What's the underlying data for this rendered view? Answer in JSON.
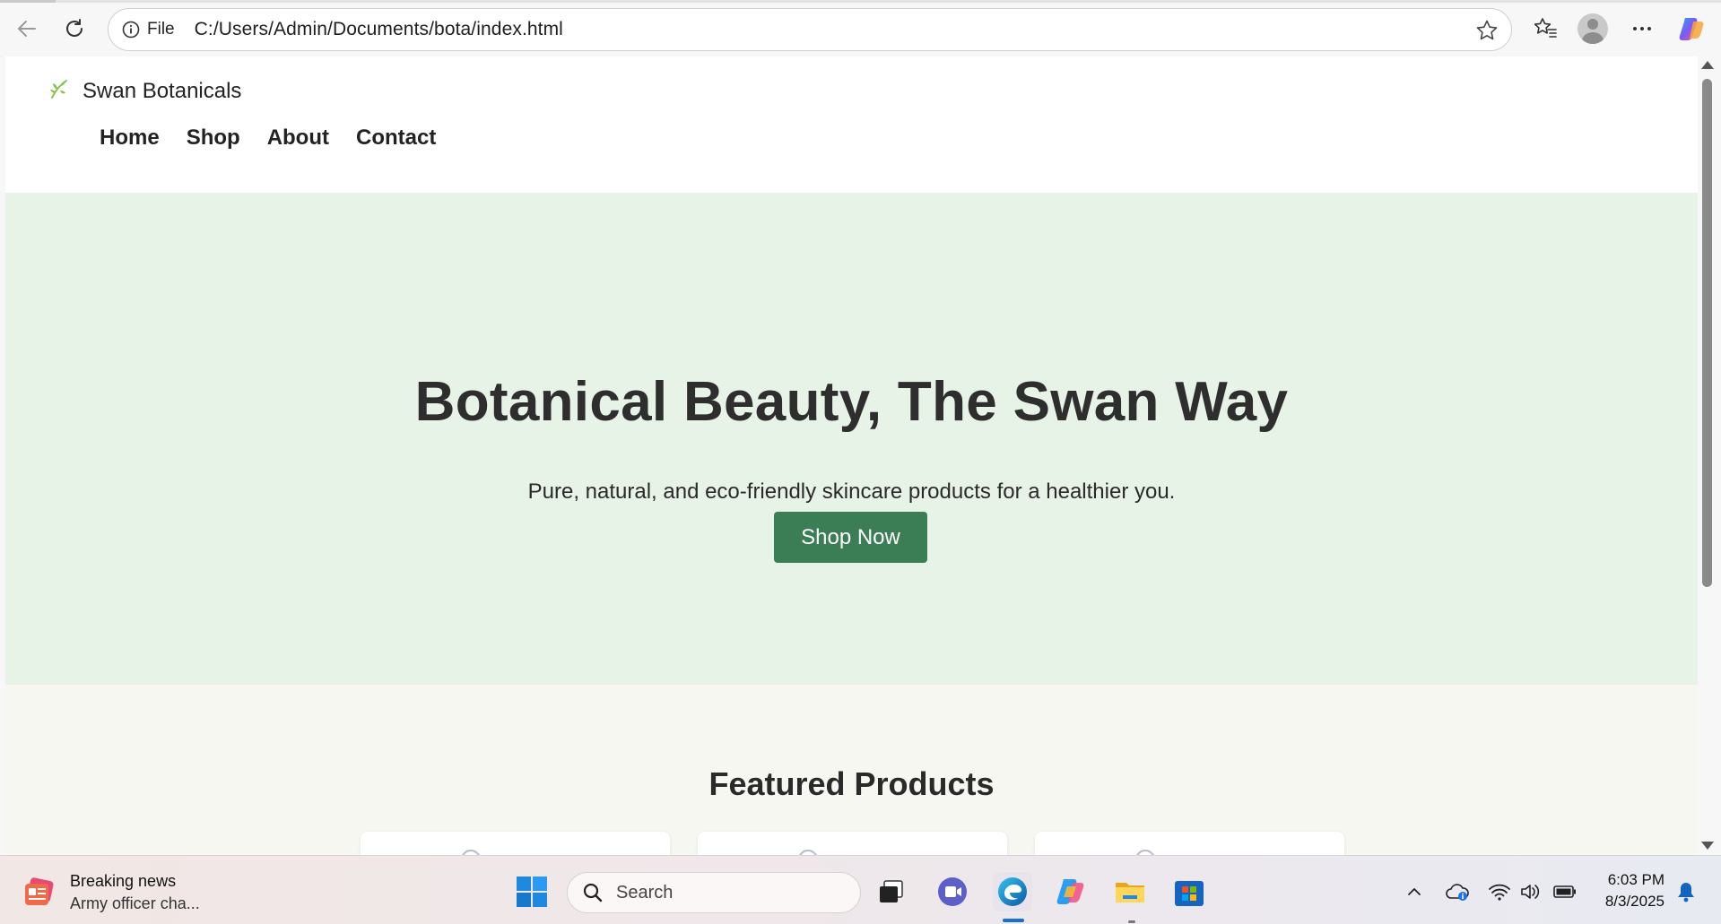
{
  "browser": {
    "address_scheme": "File",
    "address_url": "C:/Users/Admin/Documents/bota/index.html"
  },
  "site": {
    "brand_name": "Swan Botanicals",
    "nav": [
      {
        "label": "Home"
      },
      {
        "label": "Shop"
      },
      {
        "label": "About"
      },
      {
        "label": "Contact"
      }
    ],
    "hero": {
      "title": "Botanical Beauty, The Swan Way",
      "subtitle": "Pure, natural, and eco-friendly skincare products for a healthier you.",
      "cta_label": "Shop Now"
    },
    "featured": {
      "title": "Featured Products"
    },
    "colors": {
      "hero_bg": "#e6f3e6",
      "cta_bg": "#3b7d54",
      "featured_bg": "#f7f7f2"
    }
  },
  "taskbar": {
    "news_title": "Breaking news",
    "news_snippet": "Army officer cha...",
    "search_label": "Search",
    "time": "6:03 PM",
    "date": "8/3/2025"
  }
}
